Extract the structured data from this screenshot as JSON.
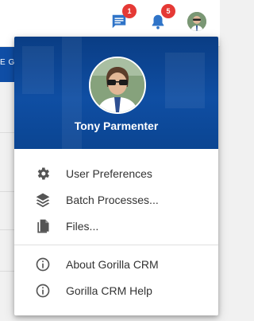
{
  "topbar": {
    "messages_badge": "1",
    "notifications_badge": "5"
  },
  "background": {
    "partial_text": "E GI"
  },
  "user_menu": {
    "user_name": "Tony Parmenter",
    "items": [
      {
        "label": "User Preferences",
        "icon": "gear-icon"
      },
      {
        "label": "Batch Processes...",
        "icon": "layers-icon"
      },
      {
        "label": "Files...",
        "icon": "file-icon"
      }
    ],
    "help_items": [
      {
        "label": "About Gorilla CRM",
        "icon": "info-icon"
      },
      {
        "label": "Gorilla CRM Help",
        "icon": "info-icon"
      }
    ]
  },
  "colors": {
    "header_blue": "#0f4ea3",
    "badge_red": "#e53935",
    "icon_gray": "#555555"
  }
}
